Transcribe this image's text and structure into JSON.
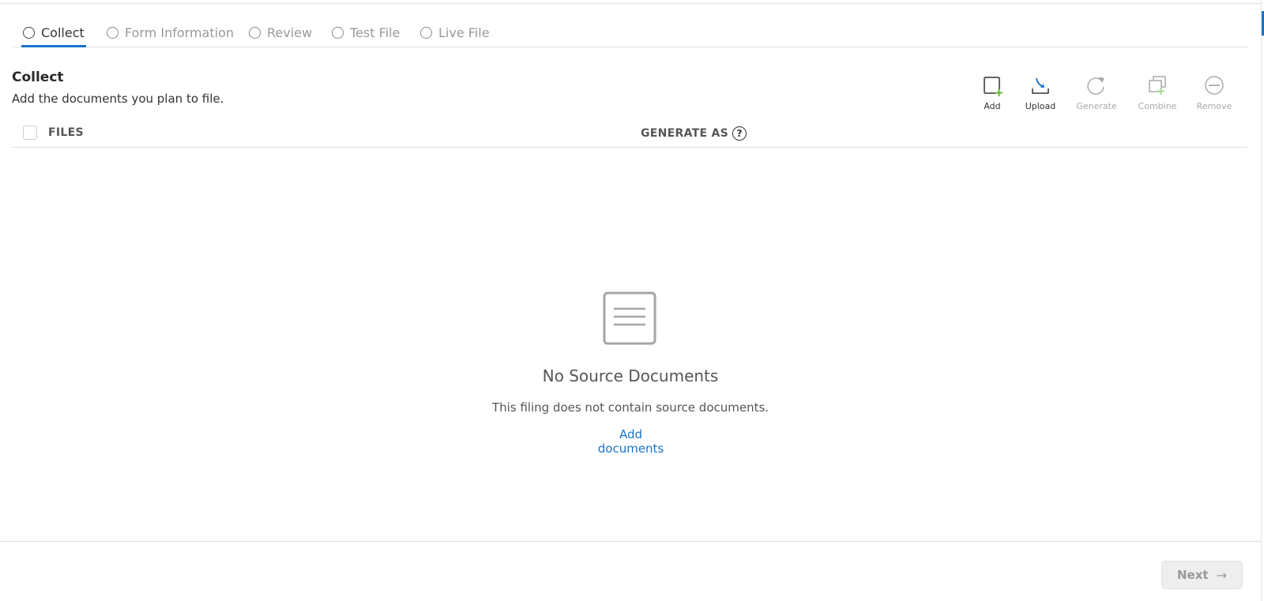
{
  "steps": [
    {
      "label": "Collect",
      "active": true
    },
    {
      "label": "Form Information",
      "active": false
    },
    {
      "label": "Review",
      "active": false
    },
    {
      "label": "Test File",
      "active": false
    },
    {
      "label": "Live File",
      "active": false
    }
  ],
  "section": {
    "title": "Collect",
    "description": "Add the documents you plan to file."
  },
  "toolbar": {
    "add": "Add",
    "upload": "Upload",
    "generate": "Generate",
    "combine": "Combine",
    "remove": "Remove"
  },
  "table": {
    "col_files": "FILES",
    "col_generate_as": "GENERATE AS",
    "help_glyph": "?"
  },
  "empty_state": {
    "title": "No Source Documents",
    "description": "This filing does not contain source documents.",
    "link": "Add documents"
  },
  "footer": {
    "next_label": "Next",
    "next_arrow": "→"
  },
  "colors": {
    "accent": "#1a73c9",
    "add_plus": "#5cb82e",
    "disabled": "#aaaaaa"
  }
}
